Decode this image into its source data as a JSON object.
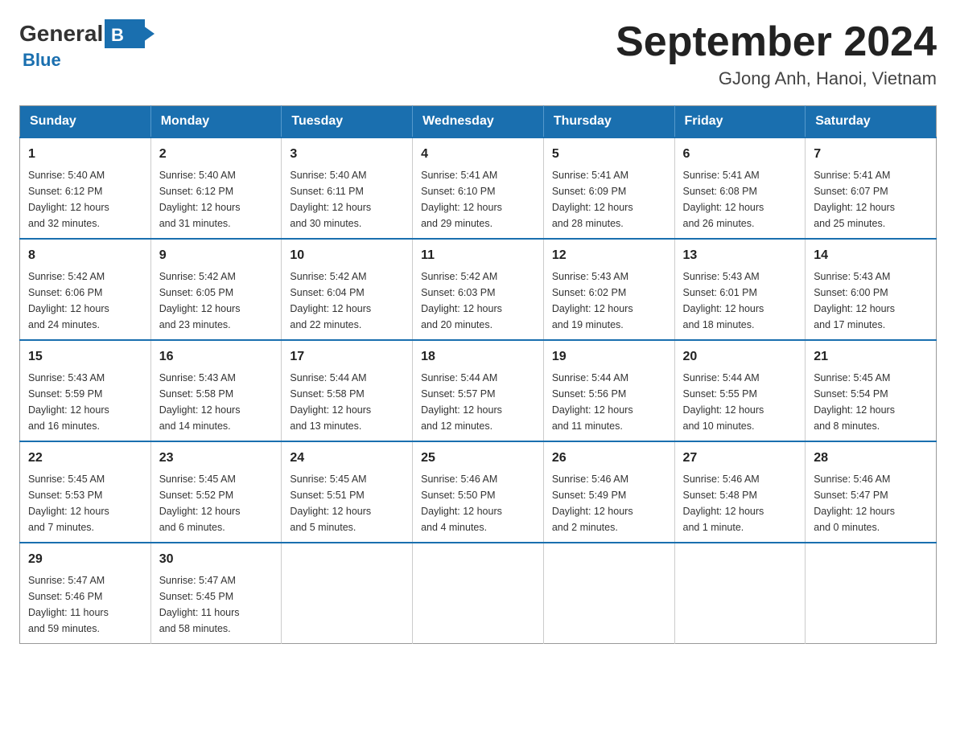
{
  "header": {
    "logo": {
      "general": "General",
      "blue": "Blue"
    },
    "title": "September 2024",
    "location": "GJong Anh, Hanoi, Vietnam"
  },
  "calendar": {
    "days_of_week": [
      "Sunday",
      "Monday",
      "Tuesday",
      "Wednesday",
      "Thursday",
      "Friday",
      "Saturday"
    ],
    "weeks": [
      [
        {
          "day": "1",
          "sunrise": "5:40 AM",
          "sunset": "6:12 PM",
          "daylight": "12 hours and 32 minutes."
        },
        {
          "day": "2",
          "sunrise": "5:40 AM",
          "sunset": "6:12 PM",
          "daylight": "12 hours and 31 minutes."
        },
        {
          "day": "3",
          "sunrise": "5:40 AM",
          "sunset": "6:11 PM",
          "daylight": "12 hours and 30 minutes."
        },
        {
          "day": "4",
          "sunrise": "5:41 AM",
          "sunset": "6:10 PM",
          "daylight": "12 hours and 29 minutes."
        },
        {
          "day": "5",
          "sunrise": "5:41 AM",
          "sunset": "6:09 PM",
          "daylight": "12 hours and 28 minutes."
        },
        {
          "day": "6",
          "sunrise": "5:41 AM",
          "sunset": "6:08 PM",
          "daylight": "12 hours and 26 minutes."
        },
        {
          "day": "7",
          "sunrise": "5:41 AM",
          "sunset": "6:07 PM",
          "daylight": "12 hours and 25 minutes."
        }
      ],
      [
        {
          "day": "8",
          "sunrise": "5:42 AM",
          "sunset": "6:06 PM",
          "daylight": "12 hours and 24 minutes."
        },
        {
          "day": "9",
          "sunrise": "5:42 AM",
          "sunset": "6:05 PM",
          "daylight": "12 hours and 23 minutes."
        },
        {
          "day": "10",
          "sunrise": "5:42 AM",
          "sunset": "6:04 PM",
          "daylight": "12 hours and 22 minutes."
        },
        {
          "day": "11",
          "sunrise": "5:42 AM",
          "sunset": "6:03 PM",
          "daylight": "12 hours and 20 minutes."
        },
        {
          "day": "12",
          "sunrise": "5:43 AM",
          "sunset": "6:02 PM",
          "daylight": "12 hours and 19 minutes."
        },
        {
          "day": "13",
          "sunrise": "5:43 AM",
          "sunset": "6:01 PM",
          "daylight": "12 hours and 18 minutes."
        },
        {
          "day": "14",
          "sunrise": "5:43 AM",
          "sunset": "6:00 PM",
          "daylight": "12 hours and 17 minutes."
        }
      ],
      [
        {
          "day": "15",
          "sunrise": "5:43 AM",
          "sunset": "5:59 PM",
          "daylight": "12 hours and 16 minutes."
        },
        {
          "day": "16",
          "sunrise": "5:43 AM",
          "sunset": "5:58 PM",
          "daylight": "12 hours and 14 minutes."
        },
        {
          "day": "17",
          "sunrise": "5:44 AM",
          "sunset": "5:58 PM",
          "daylight": "12 hours and 13 minutes."
        },
        {
          "day": "18",
          "sunrise": "5:44 AM",
          "sunset": "5:57 PM",
          "daylight": "12 hours and 12 minutes."
        },
        {
          "day": "19",
          "sunrise": "5:44 AM",
          "sunset": "5:56 PM",
          "daylight": "12 hours and 11 minutes."
        },
        {
          "day": "20",
          "sunrise": "5:44 AM",
          "sunset": "5:55 PM",
          "daylight": "12 hours and 10 minutes."
        },
        {
          "day": "21",
          "sunrise": "5:45 AM",
          "sunset": "5:54 PM",
          "daylight": "12 hours and 8 minutes."
        }
      ],
      [
        {
          "day": "22",
          "sunrise": "5:45 AM",
          "sunset": "5:53 PM",
          "daylight": "12 hours and 7 minutes."
        },
        {
          "day": "23",
          "sunrise": "5:45 AM",
          "sunset": "5:52 PM",
          "daylight": "12 hours and 6 minutes."
        },
        {
          "day": "24",
          "sunrise": "5:45 AM",
          "sunset": "5:51 PM",
          "daylight": "12 hours and 5 minutes."
        },
        {
          "day": "25",
          "sunrise": "5:46 AM",
          "sunset": "5:50 PM",
          "daylight": "12 hours and 4 minutes."
        },
        {
          "day": "26",
          "sunrise": "5:46 AM",
          "sunset": "5:49 PM",
          "daylight": "12 hours and 2 minutes."
        },
        {
          "day": "27",
          "sunrise": "5:46 AM",
          "sunset": "5:48 PM",
          "daylight": "12 hours and 1 minute."
        },
        {
          "day": "28",
          "sunrise": "5:46 AM",
          "sunset": "5:47 PM",
          "daylight": "12 hours and 0 minutes."
        }
      ],
      [
        {
          "day": "29",
          "sunrise": "5:47 AM",
          "sunset": "5:46 PM",
          "daylight": "11 hours and 59 minutes."
        },
        {
          "day": "30",
          "sunrise": "5:47 AM",
          "sunset": "5:45 PM",
          "daylight": "11 hours and 58 minutes."
        },
        null,
        null,
        null,
        null,
        null
      ]
    ],
    "labels": {
      "sunrise": "Sunrise:",
      "sunset": "Sunset:",
      "daylight": "Daylight:"
    }
  }
}
